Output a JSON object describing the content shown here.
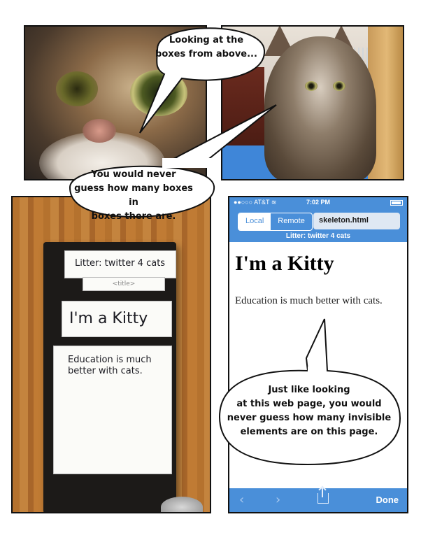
{
  "bubbles": {
    "top": {
      "line1": "Looking at the",
      "line2": "boxes from above..."
    },
    "middle": {
      "line1": "You would never",
      "line2": "guess how many boxes in",
      "line3": "boxes there are."
    },
    "bottom": {
      "line1": "Just like looking",
      "line2": "at this web page, you would",
      "line3": "never guess how many invisible",
      "line4": "elements are on this page."
    }
  },
  "boxes": {
    "card1": "Litter: twitter 4 cats",
    "card2": "<title>",
    "card3": "I'm a Kitty",
    "card4_line1": "Education is much",
    "card4_line2": "better with cats."
  },
  "phone": {
    "carrier": "●●○○○ AT&T ≋",
    "time": "7:02 PM",
    "tabs": [
      {
        "label": "Local",
        "active": true
      },
      {
        "label": "Remote",
        "active": false
      }
    ],
    "url": "skeleton.html",
    "page_title": "Litter: twitter 4 cats",
    "heading": "I'm a Kitty",
    "paragraph": "Education is much better with cats.",
    "done_label": "Done",
    "icons": [
      "back-chevron-icon",
      "forward-chevron-icon",
      "share-icon"
    ]
  }
}
